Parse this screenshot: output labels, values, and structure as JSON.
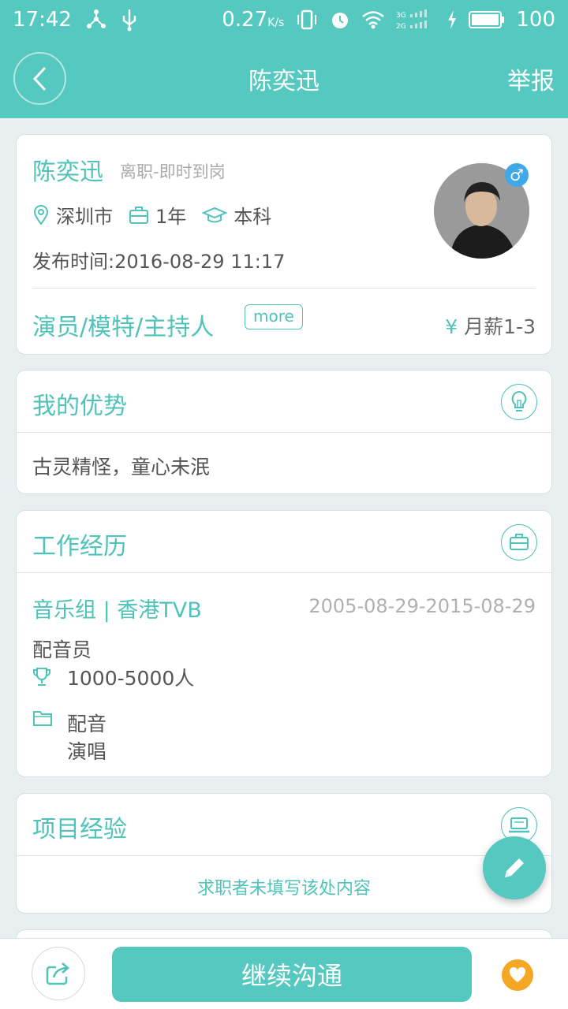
{
  "statusbar": {
    "time": "17:42",
    "speed": "0.27",
    "speed_unit": "K/s",
    "battery": "100"
  },
  "nav": {
    "title": "陈奕迅",
    "report": "举报"
  },
  "profile": {
    "name": "陈奕迅",
    "status": "离职-即时到岗",
    "city": "深圳市",
    "experience": "1年",
    "education": "本科",
    "publish_time": "发布时间:2016-08-29 11:17",
    "gender_symbol": "♂",
    "job": "演员/模特/主持人",
    "more": "more",
    "salary_symbol": "¥",
    "salary": "月薪1-3"
  },
  "advantage": {
    "title": "我的优势",
    "text": "古灵精怪，童心未泯"
  },
  "work": {
    "title": "工作经历",
    "company": "音乐组 | 香港TVB",
    "period": "2005-08-29-2015-08-29",
    "role": "配音员",
    "size": "1000-5000人",
    "duties": [
      "配音",
      "演唱"
    ]
  },
  "project": {
    "title": "项目经验",
    "empty": "求职者未填写该处内容"
  },
  "bottom": {
    "continue": "继续沟通"
  },
  "colors": {
    "accent": "#55c8bf",
    "gender": "#3fa8e8",
    "favorite": "#f5a623"
  }
}
